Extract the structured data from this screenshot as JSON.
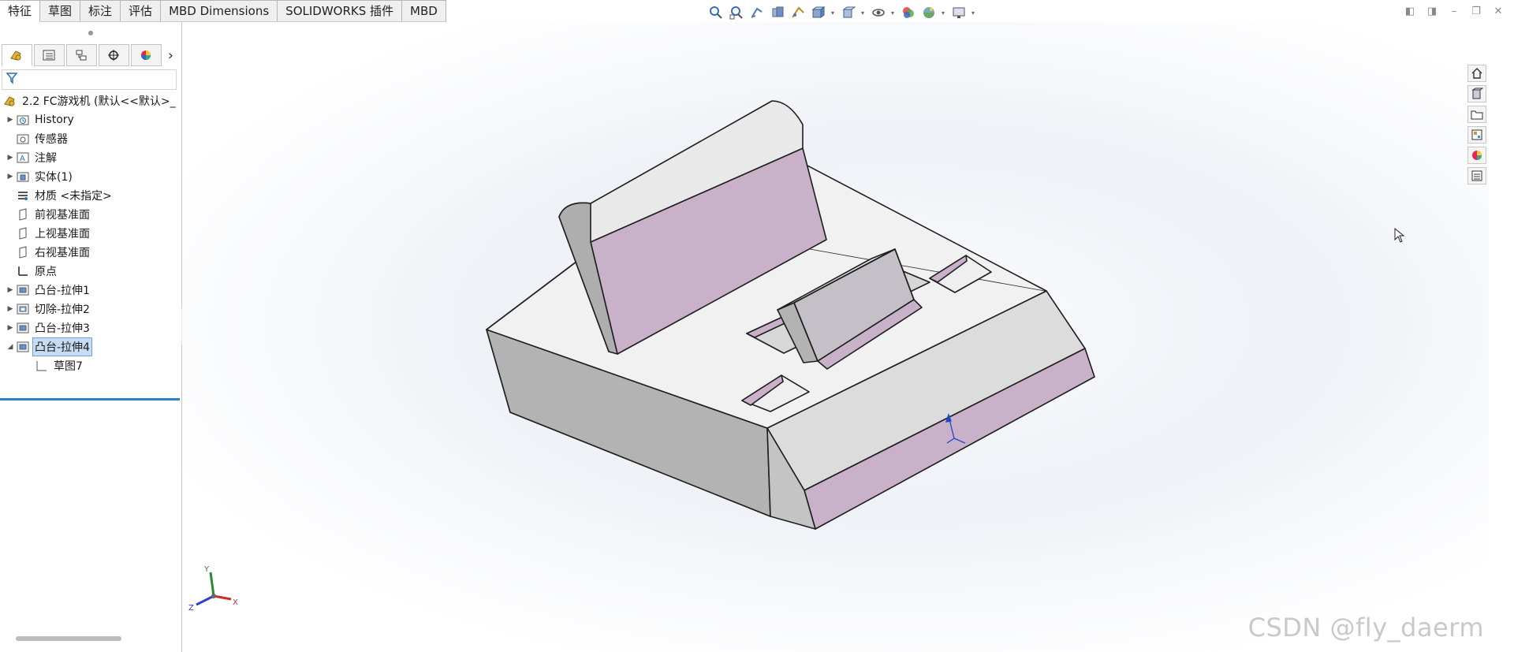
{
  "command_tabs": [
    "特征",
    "草图",
    "标注",
    "评估",
    "MBD Dimensions",
    "SOLIDWORKS 插件",
    "MBD"
  ],
  "active_tab_index": 0,
  "view_toolbar_icons": [
    "zoom-to-fit-icon",
    "zoom-to-area-icon",
    "previous-view-icon",
    "section-view-icon",
    "dynamic-annotation-icon",
    "view-orientation-icon",
    "display-style-icon",
    "hide-show-items-icon",
    "edit-appearance-icon",
    "apply-scene-icon",
    "view-settings-icon"
  ],
  "feature_manager": {
    "tab_icons": [
      "featuremanager-icon",
      "propertymanager-icon",
      "configurationmanager-icon",
      "dimxpert-icon",
      "display-manager-icon"
    ],
    "more_glyph": "›",
    "root_label": "2.2 FC游戏机  (默认<<默认>_",
    "items": [
      {
        "label": "History",
        "icon": "history-icon",
        "expandable": true,
        "indent": 0
      },
      {
        "label": "传感器",
        "icon": "sensors-icon",
        "expandable": false,
        "indent": 0
      },
      {
        "label": "注解",
        "icon": "annotations-icon",
        "expandable": true,
        "indent": 0
      },
      {
        "label": "实体(1)",
        "icon": "solid-bodies-icon",
        "expandable": true,
        "indent": 0
      },
      {
        "label": "材质 <未指定>",
        "icon": "material-icon",
        "expandable": false,
        "indent": 0
      },
      {
        "label": "前视基准面",
        "icon": "plane-icon",
        "expandable": false,
        "indent": 0
      },
      {
        "label": "上视基准面",
        "icon": "plane-icon",
        "expandable": false,
        "indent": 0
      },
      {
        "label": "右视基准面",
        "icon": "plane-icon",
        "expandable": false,
        "indent": 0
      },
      {
        "label": "原点",
        "icon": "origin-icon",
        "expandable": false,
        "indent": 0
      },
      {
        "label": "凸台-拉伸1",
        "icon": "boss-extrude-icon",
        "expandable": true,
        "indent": 0
      },
      {
        "label": "切除-拉伸2",
        "icon": "cut-extrude-icon",
        "expandable": true,
        "indent": 0
      },
      {
        "label": "凸台-拉伸3",
        "icon": "boss-extrude-icon",
        "expandable": true,
        "indent": 0
      },
      {
        "label": "凸台-拉伸4",
        "icon": "boss-extrude-icon",
        "expandable": true,
        "expanded": true,
        "selected": true,
        "indent": 0
      },
      {
        "label": "草图7",
        "icon": "sketch-icon",
        "expandable": false,
        "indent": 1
      }
    ]
  },
  "triad": {
    "x": "X",
    "y": "Y",
    "z": "Z"
  },
  "task_pane_icons": [
    "home-icon",
    "design-library-icon",
    "file-explorer-icon",
    "view-palette-icon",
    "appearances-icon",
    "custom-properties-icon"
  ],
  "watermark": "CSDN @fly_daerm",
  "colors": {
    "face_highlight": "#c9b1c9",
    "face_light": "#ececec",
    "face_mid": "#dcdcdc",
    "face_dark": "#b4b4b4",
    "selection": "#c6dcf2"
  }
}
